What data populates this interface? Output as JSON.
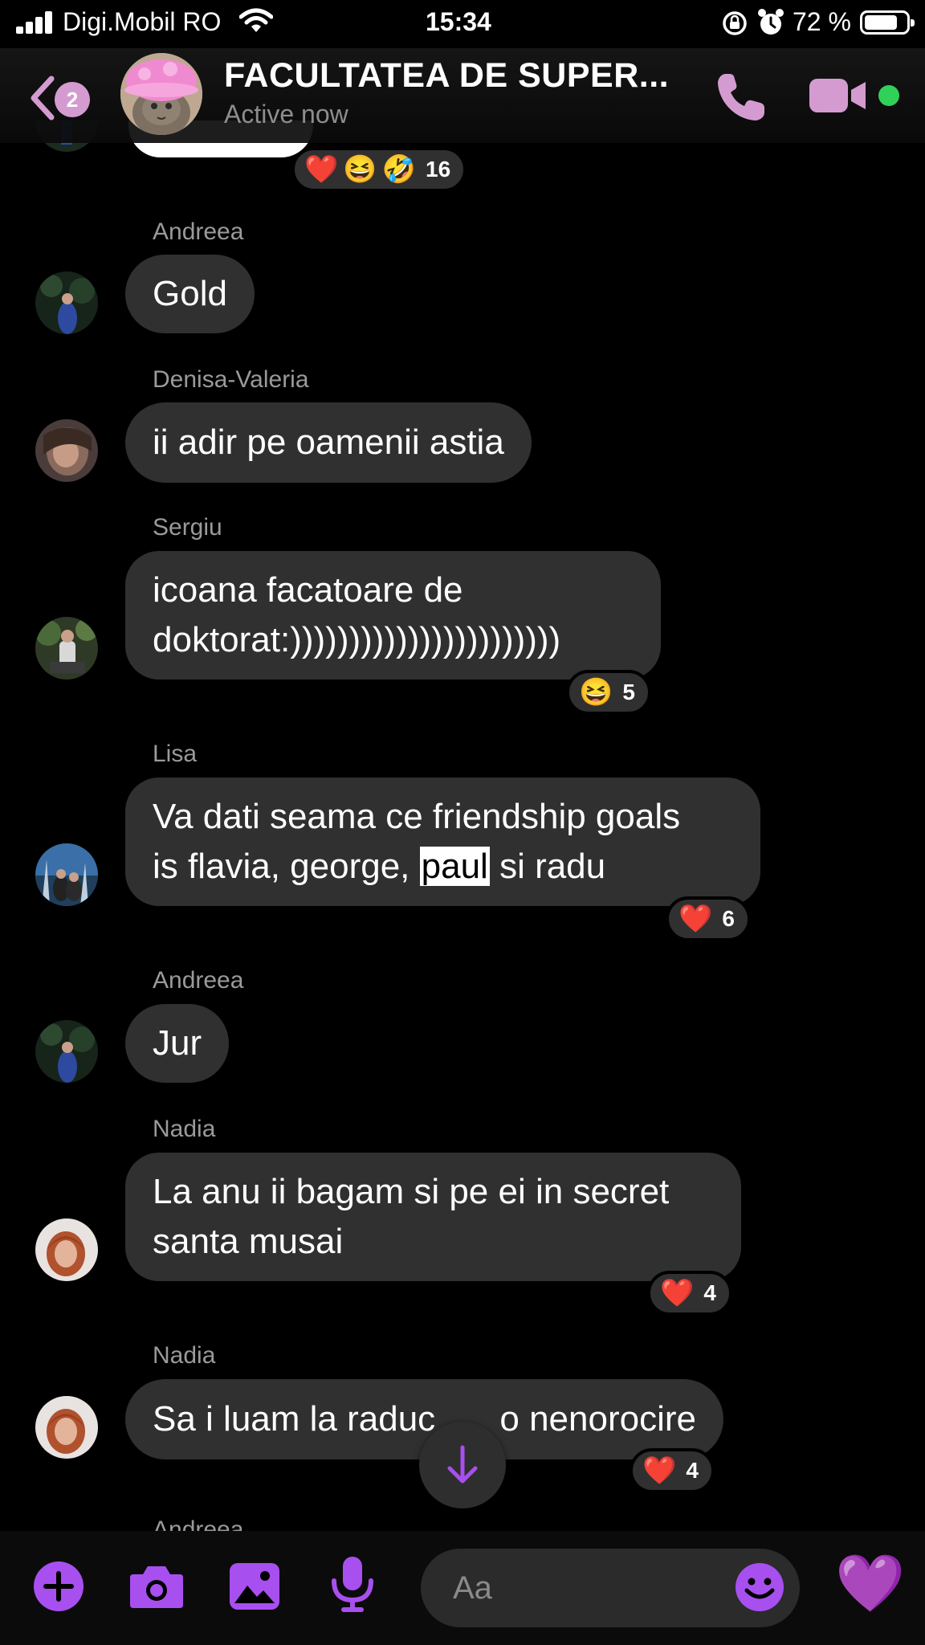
{
  "status_bar": {
    "carrier": "Digi.Mobil RO",
    "time": "15:34",
    "battery_percent": "72 %",
    "battery_level": 0.72
  },
  "header": {
    "back_badge": "2",
    "title": "FACULTATEA DE SUPER...",
    "subtitle": "Active now",
    "icons": [
      "back-chevron-icon",
      "phone-icon",
      "video-camera-icon"
    ],
    "accent_color": "#d49bd1"
  },
  "top_reaction": {
    "emojis": [
      "❤️",
      "😆",
      "🤣"
    ],
    "count": "16"
  },
  "messages": [
    {
      "sender": "Andreea",
      "text": "Gold"
    },
    {
      "sender": "Denisa-Valeria",
      "text": "ii adir pe oamenii astia"
    },
    {
      "sender": "Sergiu",
      "lines": [
        "icoana facatoare de",
        "doktorat:)))))))))))))))))))))))"
      ],
      "reaction": {
        "emoji": "😆",
        "count": "5"
      }
    },
    {
      "sender": "Lisa",
      "lines": [
        "Va dati seama ce friendship goals",
        "is flavia, george,",
        "paul",
        "si radu"
      ],
      "reaction": {
        "emoji": "❤️",
        "count": "6"
      }
    },
    {
      "sender": "Andreea",
      "text": "Jur"
    },
    {
      "sender": "Nadia",
      "lines": [
        "La anu ii bagam si pe ei in secret",
        "santa musai"
      ],
      "reaction": {
        "emoji": "❤️",
        "count": "4"
      }
    },
    {
      "sender": "Nadia",
      "text_left": "Sa i luam la raduc",
      "text_right": "o nenorocire",
      "reaction": {
        "emoji": "❤️",
        "count": "4"
      }
    }
  ],
  "peek_sender": "Andreea",
  "composer": {
    "placeholder": "Aa",
    "heart": "💜",
    "icons": [
      "plus-icon",
      "camera-icon",
      "image-icon",
      "microphone-icon",
      "emoji-icon",
      "heart-icon"
    ],
    "accent_color": "#a84ff0"
  }
}
